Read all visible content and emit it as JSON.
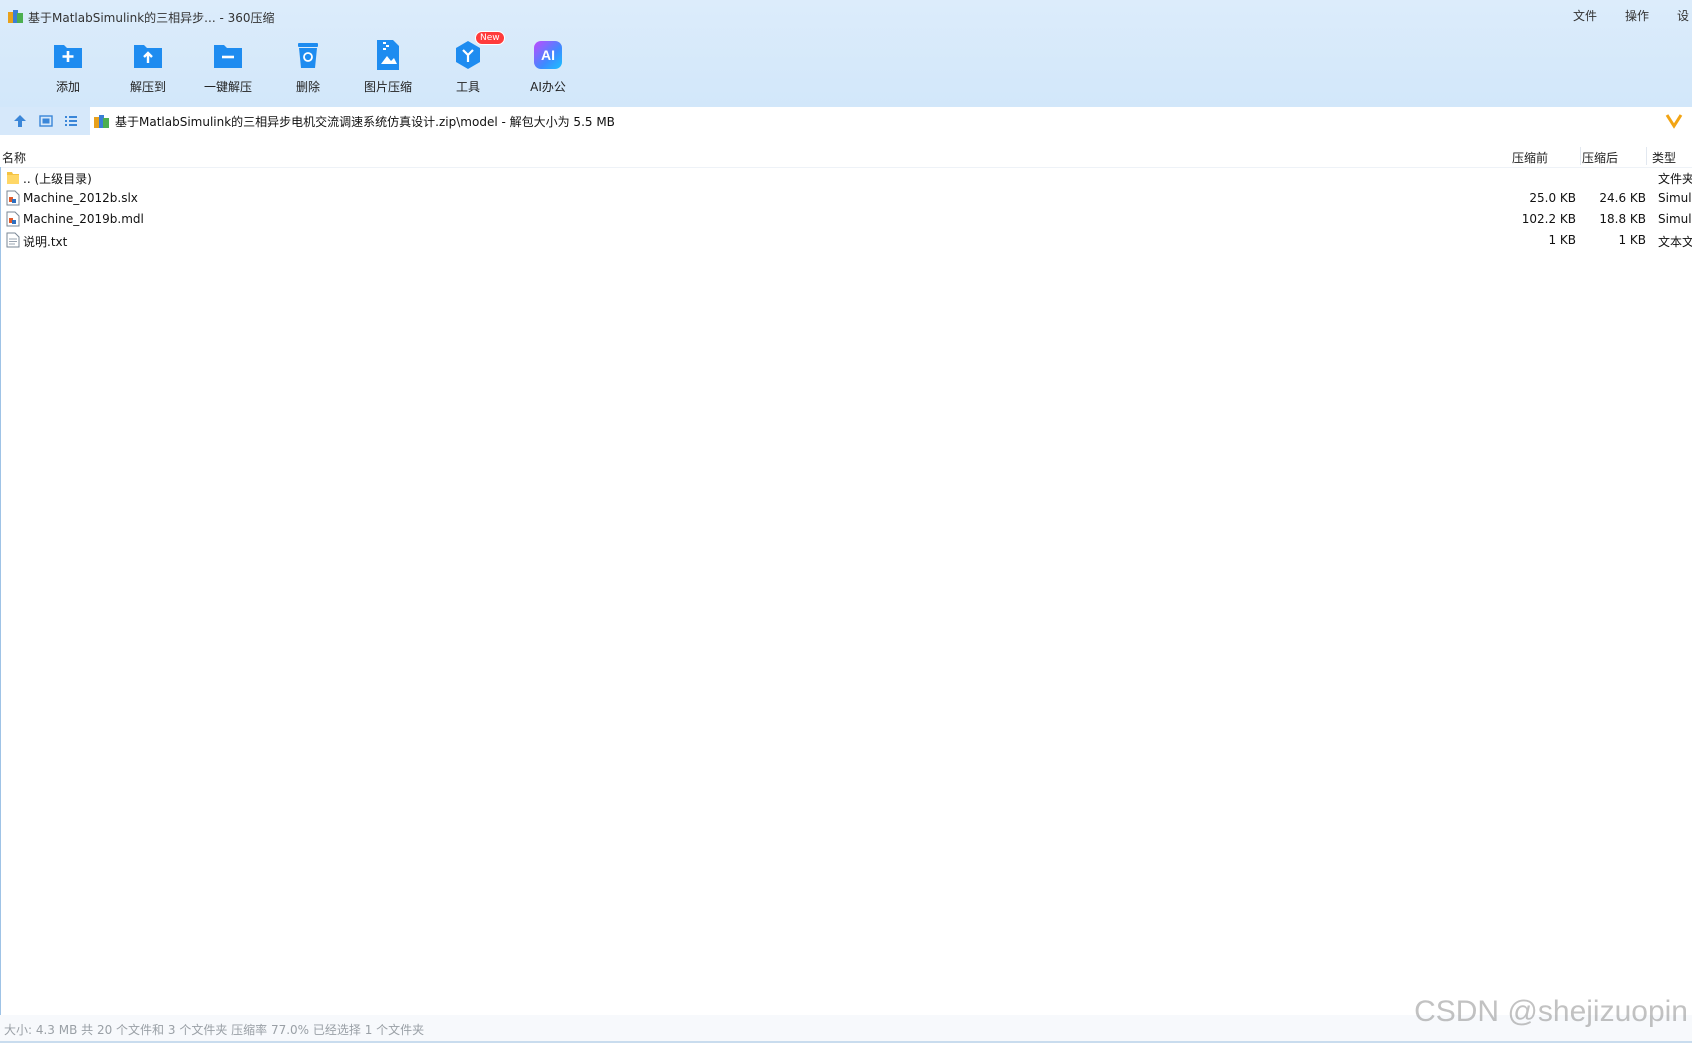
{
  "window": {
    "title": "基于MatlabSimulink的三相异步... - 360压缩",
    "menu": [
      "文件",
      "操作",
      "设"
    ]
  },
  "toolbar": {
    "items": [
      {
        "label": "添加",
        "icon": "add-icon"
      },
      {
        "label": "解压到",
        "icon": "extract-to-icon"
      },
      {
        "label": "一键解压",
        "icon": "one-click-extract-icon"
      },
      {
        "label": "删除",
        "icon": "delete-icon"
      },
      {
        "label": "图片压缩",
        "icon": "image-compress-icon"
      },
      {
        "label": "工具",
        "icon": "tools-icon",
        "badge": "New"
      },
      {
        "label": "AI办公",
        "icon": "ai-office-icon",
        "icon_text": "AI"
      }
    ]
  },
  "nav": {
    "path": "基于MatlabSimulink的三相异步电机交流调速系统仿真设计.zip\\model - 解包大小为 5.5 MB",
    "chevron": "V"
  },
  "columns": {
    "name": "名称",
    "before": "压缩前",
    "after": "压缩后",
    "type": "类型"
  },
  "files": [
    {
      "name": ".. (上级目录)",
      "before": "",
      "after": "",
      "type": "文件夹",
      "icon": "folder-icon"
    },
    {
      "name": "Machine_2012b.slx",
      "before": "25.0 KB",
      "after": "24.6 KB",
      "type": "Simulink",
      "icon": "simulink-file-icon"
    },
    {
      "name": "Machine_2019b.mdl",
      "before": "102.2 KB",
      "after": "18.8 KB",
      "type": "Simulink",
      "icon": "simulink-file-icon"
    },
    {
      "name": "说明.txt",
      "before": "1 KB",
      "after": "1 KB",
      "type": "文本文档",
      "icon": "text-file-icon"
    }
  ],
  "status": "大小: 4.3 MB 共 20 个文件和 3 个文件夹 压缩率 77.0% 已经选择 1 个文件夹",
  "watermark": "CSDN @shejizuopin",
  "colors": {
    "accent": "#1e8cf0",
    "titlebar": "#d6e8fa",
    "badge": "#ff3b3b"
  }
}
